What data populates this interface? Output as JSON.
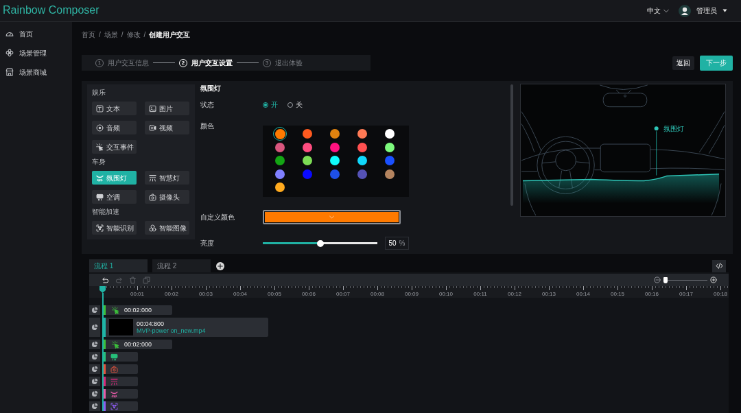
{
  "header": {
    "app_title": "Rainbow Composer",
    "language": "中文",
    "user": "管理员"
  },
  "sidebar": {
    "items": [
      {
        "label": "首页",
        "kind": "home"
      },
      {
        "label": "场景管理",
        "kind": "scenes"
      },
      {
        "label": "场景商城",
        "kind": "store"
      }
    ]
  },
  "breadcrumb": {
    "separator": "/",
    "items": [
      {
        "label": "首页",
        "current": false
      },
      {
        "label": "场景",
        "current": false
      },
      {
        "label": "修改",
        "current": false
      },
      {
        "label": "创建用户交互",
        "current": true
      }
    ]
  },
  "steps": [
    {
      "number": "1",
      "label": "用户交互信息",
      "selected": false
    },
    {
      "number": "2",
      "label": "用户交互设置",
      "selected": true
    },
    {
      "number": "3",
      "label": "退出体验",
      "selected": false
    }
  ],
  "actions": [
    {
      "label": "返回",
      "kind": "secondary"
    },
    {
      "label": "下一步",
      "kind": "primary"
    }
  ],
  "palette": {
    "groups": [
      {
        "title": "娱乐",
        "items": [
          {
            "label": "文本",
            "kind": "text",
            "selected": false
          },
          {
            "label": "图片",
            "kind": "image",
            "selected": false
          },
          {
            "label": "音频",
            "kind": "audio",
            "selected": false
          },
          {
            "label": "视频",
            "kind": "video",
            "selected": false
          },
          {
            "label": "交互事件",
            "kind": "event",
            "selected": false
          }
        ]
      },
      {
        "title": "车身",
        "items": [
          {
            "label": "氛围灯",
            "kind": "ambient_light",
            "selected": true
          },
          {
            "label": "智慧灯",
            "kind": "smart_light",
            "selected": false
          },
          {
            "label": "空调",
            "kind": "ac",
            "selected": false
          },
          {
            "label": "摄像头",
            "kind": "camera",
            "selected": false
          }
        ]
      },
      {
        "title": "智能加速",
        "items": [
          {
            "label": "智能识别",
            "kind": "recognition",
            "selected": false
          },
          {
            "label": "智能图像",
            "kind": "smart_image",
            "selected": false
          }
        ]
      }
    ]
  },
  "properties": {
    "title": "氛围灯",
    "status": {
      "label": "状态",
      "options": [
        {
          "label": "开",
          "selected": true
        },
        {
          "label": "关",
          "selected": false
        }
      ]
    },
    "color": {
      "label": "颜色",
      "swatches": [
        {
          "color": "#ff7a00",
          "selected": true
        },
        {
          "color": "#ff5a1f",
          "selected": false
        },
        {
          "color": "#e0820f",
          "selected": false
        },
        {
          "color": "#ff7a55",
          "selected": false
        },
        {
          "color": "#ffffff",
          "selected": false
        },
        {
          "color": "#d9567e",
          "selected": false
        },
        {
          "color": "#ff4d80",
          "selected": false
        },
        {
          "color": "#ff1280",
          "selected": false
        },
        {
          "color": "#ff5050",
          "selected": false
        },
        {
          "color": "#7dfa7d",
          "selected": false
        },
        {
          "color": "#14a514",
          "selected": false
        },
        {
          "color": "#7ddc55",
          "selected": false
        },
        {
          "color": "#10fcfc",
          "selected": false
        },
        {
          "color": "#10d8fc",
          "selected": false
        },
        {
          "color": "#1a50ff",
          "selected": false
        },
        {
          "color": "#8080ff",
          "selected": false
        },
        {
          "color": "#0a0aff",
          "selected": false
        },
        {
          "color": "#1e50e6",
          "selected": false
        },
        {
          "color": "#5552b5",
          "selected": false
        },
        {
          "color": "#b4845f",
          "selected": false
        },
        {
          "color": "#ffaa1e",
          "selected": false
        }
      ]
    },
    "custom_color": {
      "label": "自定义颜色"
    },
    "brightness": {
      "label": "亮度",
      "level": 0.5,
      "value": "50",
      "unit": "%"
    }
  },
  "preview": {
    "hotspot_label": "氛围灯"
  },
  "timeline": {
    "tabs": [
      {
        "label": "流程 1",
        "selected": true
      },
      {
        "label": "流程 2",
        "selected": false
      }
    ],
    "tools": [
      {
        "kind": "undo",
        "disabled": false
      },
      {
        "kind": "redo",
        "disabled": true
      },
      {
        "kind": "delete",
        "disabled": true
      },
      {
        "kind": "copy",
        "disabled": true
      }
    ],
    "zoom": {
      "level": 0.05
    },
    "ruler": [
      "00:01",
      "00:02",
      "00:03",
      "00:04",
      "00:05",
      "00:06",
      "00:07",
      "00:08",
      "00:09",
      "00:10",
      "00:11",
      "00:12",
      "00:13",
      "00:14",
      "00:15",
      "00:16",
      "00:17",
      "00:18"
    ],
    "tracks": [
      {
        "kind": "event",
        "color": "#3cc13b",
        "duration": "00:02:000"
      },
      {
        "kind": "video",
        "color": "#1fb5a8",
        "duration": "00:04:800",
        "file": "MVP-power on_new.mp4"
      },
      {
        "kind": "event",
        "color": "#3cc13b",
        "duration": "00:02:000"
      },
      {
        "kind": "ac",
        "color": "#27c07a"
      },
      {
        "kind": "camera",
        "color": "#e5533d"
      },
      {
        "kind": "smart_light",
        "color": "#d9287a"
      },
      {
        "kind": "ambient_light",
        "color": "#e85aa8"
      },
      {
        "kind": "recognition",
        "color": "#8c5cf0"
      }
    ]
  }
}
